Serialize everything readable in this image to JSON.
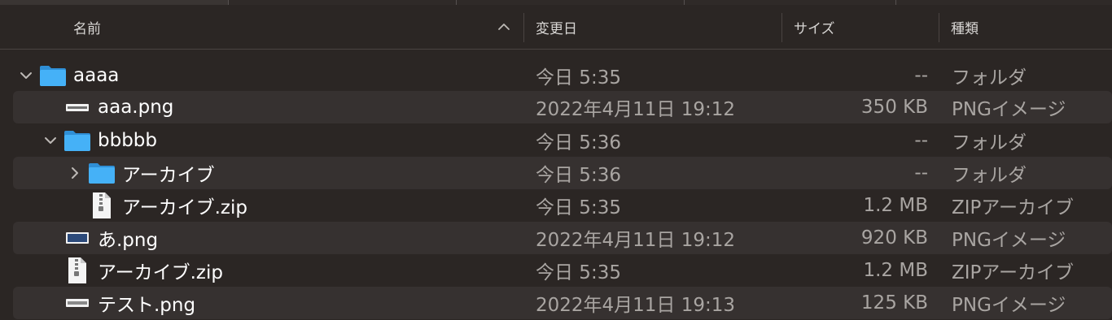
{
  "header": {
    "columns": [
      {
        "key": "name",
        "label": "名前"
      },
      {
        "key": "date",
        "label": "変更日"
      },
      {
        "key": "size",
        "label": "サイズ"
      },
      {
        "key": "kind",
        "label": "種類"
      }
    ]
  },
  "rows": [
    {
      "name": "aaaa",
      "date": "今日 5:35",
      "size": "--",
      "kind": "フォルダ",
      "icon": "folder-icon",
      "expand": "chevron-down-icon"
    },
    {
      "name": "aaa.png",
      "date": "2022年4月11日 19:12",
      "size": "350 KB",
      "kind": "PNGイメージ",
      "icon": "image-file-icon"
    },
    {
      "name": "bbbbb",
      "date": "今日 5:36",
      "size": "--",
      "kind": "フォルダ",
      "icon": "folder-icon",
      "expand": "chevron-down-icon"
    },
    {
      "name": "アーカイブ",
      "date": "今日 5:36",
      "size": "--",
      "kind": "フォルダ",
      "icon": "folder-icon",
      "expand": "chevron-right-icon"
    },
    {
      "name": "アーカイブ.zip",
      "date": "今日 5:35",
      "size": "1.2 MB",
      "kind": "ZIPアーカイブ",
      "icon": "zip-file-icon"
    },
    {
      "name": "あ.png",
      "date": "2022年4月11日 19:12",
      "size": "920 KB",
      "kind": "PNGイメージ",
      "icon": "image-file-icon"
    },
    {
      "name": "アーカイブ.zip",
      "date": "今日 5:35",
      "size": "1.2 MB",
      "kind": "ZIPアーカイブ",
      "icon": "zip-file-icon"
    },
    {
      "name": "テスト.png",
      "date": "2022年4月11日 19:13",
      "size": "125 KB",
      "kind": "PNGイメージ",
      "icon": "image-file-icon"
    }
  ],
  "colors": {
    "background": "#2b2624",
    "alt_row": "#363130",
    "folder_blue": "#3fa9f5",
    "secondary_text": "#a9a5a2"
  }
}
